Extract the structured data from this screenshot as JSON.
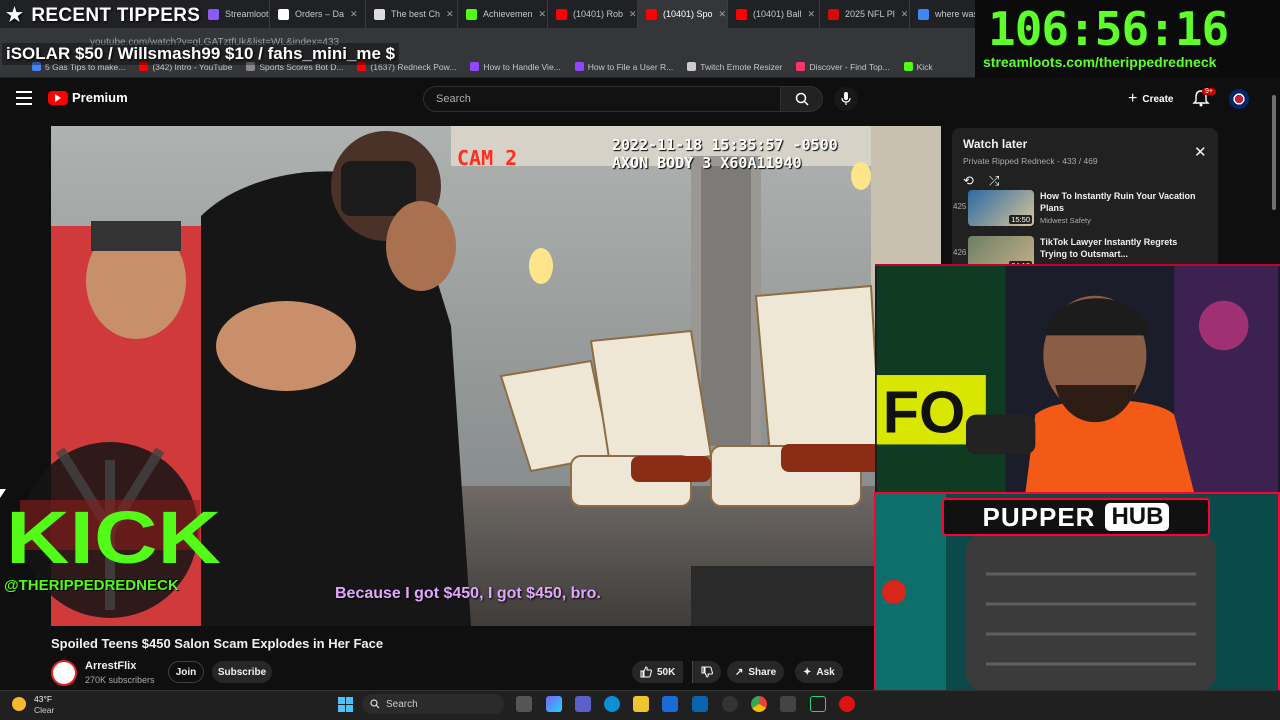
{
  "browser": {
    "tabs": [
      {
        "label": "Streamloots",
        "color": "#8a5cf6",
        "active": false
      },
      {
        "label": "Orders – Da",
        "color": "#ffffff",
        "active": false
      },
      {
        "label": "The best Ch",
        "color": "#dddddd",
        "active": false
      },
      {
        "label": "Achievemen",
        "color": "#53fc18",
        "active": false
      },
      {
        "label": "(10401) Rob",
        "color": "#ff0000",
        "active": false
      },
      {
        "label": "(10401) Spo",
        "color": "#ff0000",
        "active": true
      },
      {
        "label": "(10401) Ball",
        "color": "#ff0000",
        "active": false
      },
      {
        "label": "2025 NFL Pl",
        "color": "#d50a0a",
        "active": false
      },
      {
        "label": "where was",
        "color": "#4285f4",
        "active": false
      }
    ],
    "url": "youtube.com/watch?v=qLGATztfUk&list=WL&index=433",
    "bookmarks": [
      {
        "label": "5 Gas Tips to make...",
        "color": "#4285f4"
      },
      {
        "label": "(342) Intro - YouTube",
        "color": "#ff0000"
      },
      {
        "label": "Sports Scores Bot D...",
        "color": "#888888"
      },
      {
        "label": "(1637) Redneck Pow...",
        "color": "#ff0000"
      },
      {
        "label": "How to Handle Vie...",
        "color": "#9146ff"
      },
      {
        "label": "How to File a User R...",
        "color": "#9146ff"
      },
      {
        "label": "Twitch Emote Resizer",
        "color": "#cccccc"
      },
      {
        "label": "Discover - Find Top...",
        "color": "#ff3366"
      },
      {
        "label": "Kick",
        "color": "#53fc18"
      }
    ]
  },
  "overlay": {
    "tippers_title": "RECENT TIPPERS",
    "tippers_list": "iSOLAR $50 / Willsmash99 $10 / fahs_mini_me $",
    "countdown": "106:56:16",
    "streamloots_url": "streamloots.com/therippedredneck",
    "kick_handle": "@THERIPPEDREDNECK",
    "pupper_word": "PUPPER",
    "hub_word": "HUB",
    "colors": {
      "kick_green": "#53fc18",
      "timer_green": "#5dff2a",
      "pupper_red": "#ff0030"
    }
  },
  "youtube": {
    "logo_text": "Premium",
    "search_placeholder": "Search",
    "create_label": "Create",
    "notification_badge": "9+",
    "video": {
      "cam_label": "CAM 2",
      "timestamp_line1": "2022-11-18  15:35:57 -0500",
      "timestamp_line2": "AXON BODY 3 X60A11940",
      "caption": "Because I got $450, I got $450, bro."
    },
    "title": "Spoiled Teens $450 Salon Scam Explodes in Her Face",
    "channel": {
      "name": "ArrestFlix",
      "subscribers": "270K subscribers"
    },
    "join_label": "Join",
    "subscribe_label": "Subscribe",
    "like_count": "50K",
    "share_label": "Share",
    "ask_label": "Ask",
    "playlist": {
      "title": "Watch later",
      "subtitle": "Private  Ripped Redneck - 433 / 469",
      "items": [
        {
          "index": "425",
          "title": "How To Instantly Ruin Your Vacation Plans",
          "channel": "Midwest Safety",
          "duration": "15:50"
        },
        {
          "index": "426",
          "title": "TikTok Lawyer Instantly Regrets Trying to Outsmart...",
          "channel": "",
          "duration": "24:13"
        }
      ]
    }
  },
  "taskbar": {
    "weather_temp": "43°F",
    "weather_desc": "Clear",
    "search_label": "Search"
  }
}
